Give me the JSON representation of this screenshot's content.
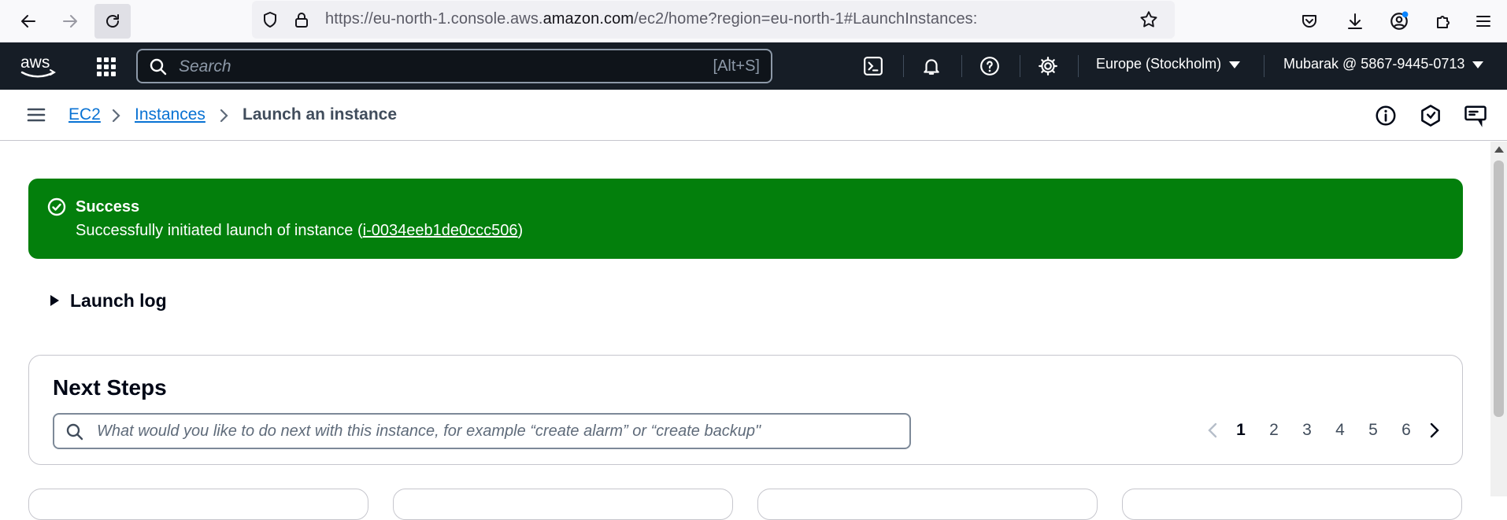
{
  "browser": {
    "url_prefix": "https://eu-north-1.console.aws.",
    "url_host": "amazon.com",
    "url_suffix": "/ec2/home?region=eu-north-1#LaunchInstances:"
  },
  "topbar": {
    "search_placeholder": "Search",
    "search_shortcut": "[Alt+S]",
    "region": "Europe (Stockholm)",
    "account": "Mubarak @ 5867-9445-0713"
  },
  "breadcrumb": {
    "items": [
      "EC2",
      "Instances"
    ],
    "current": "Launch an instance"
  },
  "alert": {
    "title": "Success",
    "message_prefix": "Successfully initiated launch of instance (",
    "instance_id": "i-0034eeb1de0ccc506",
    "message_suffix": ")"
  },
  "launch_log": {
    "label": "Launch log"
  },
  "next_steps": {
    "title": "Next Steps",
    "search_placeholder": "What would you like to do next with this instance, for example “create alarm” or “create backup\"",
    "pages": [
      "1",
      "2",
      "3",
      "4",
      "5",
      "6"
    ],
    "current_page": "1"
  },
  "colors": {
    "success": "#037f0c",
    "link": "#0972d3",
    "topbar": "#161d26"
  }
}
